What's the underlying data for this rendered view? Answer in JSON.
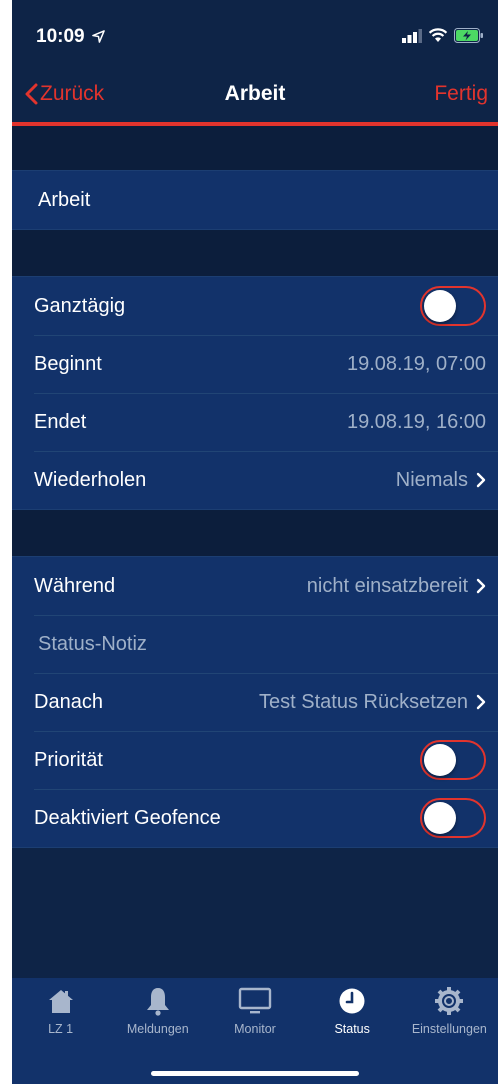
{
  "statusbar": {
    "time": "10:09"
  },
  "nav": {
    "back_label": "Zurück",
    "title": "Arbeit",
    "done_label": "Fertig"
  },
  "title_field": {
    "value": "Arbeit"
  },
  "schedule": {
    "allday_label": "Ganztägig",
    "allday_on": false,
    "begin_label": "Beginnt",
    "begin_value": "19.08.19, 07:00",
    "end_label": "Endet",
    "end_value": "19.08.19, 16:00",
    "repeat_label": "Wiederholen",
    "repeat_value": "Niemals"
  },
  "status": {
    "during_label": "Während",
    "during_value": "nicht einsatzbereit",
    "note_placeholder": "Status-Notiz",
    "after_label": "Danach",
    "after_value": "Test Status Rücksetzen",
    "priority_label": "Priorität",
    "priority_on": false,
    "geofence_label": "Deaktiviert Geofence",
    "geofence_on": false
  },
  "tabbar": {
    "tabs": [
      {
        "label": "LZ 1",
        "icon": "home-icon",
        "active": false
      },
      {
        "label": "Meldungen",
        "icon": "bell-icon",
        "active": false
      },
      {
        "label": "Monitor",
        "icon": "monitor-icon",
        "active": false
      },
      {
        "label": "Status",
        "icon": "clock-icon",
        "active": true
      },
      {
        "label": "Einstellungen",
        "icon": "gear-icon",
        "active": false
      }
    ]
  },
  "colors": {
    "accent": "#e2342d",
    "background": "#0e2447",
    "cell": "#12326a",
    "secondary_text": "#9fb0c8"
  }
}
